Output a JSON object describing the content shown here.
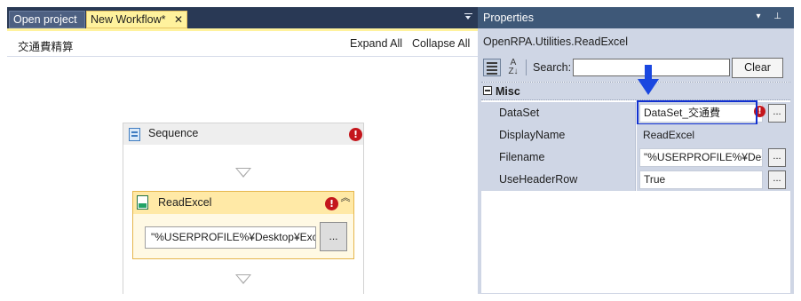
{
  "tabs": {
    "open_project": "Open project",
    "workflow": "New Workflow*",
    "close_glyph": "✕"
  },
  "designer": {
    "workflow_name": "交通費精算",
    "expand_all": "Expand All",
    "collapse_all": "Collapse All",
    "sequence": {
      "title": "Sequence",
      "error_glyph": "!"
    },
    "activity": {
      "title": "ReadExcel",
      "error_glyph": "!",
      "filename_value": "\"%USERPROFILE%¥Desktop¥Exc",
      "browse_label": "..."
    }
  },
  "properties": {
    "title": "Properties",
    "type_name": "OpenRPA.Utilities.ReadExcel",
    "search_label": "Search:",
    "search_value": "",
    "clear_label": "Clear",
    "category": "Misc",
    "rows": [
      {
        "name": "DataSet",
        "value": "DataSet_交通費",
        "button": "...",
        "error": "!"
      },
      {
        "name": "DisplayName",
        "value": "ReadExcel"
      },
      {
        "name": "Filename",
        "value": "\"%USERPROFILE%¥Desk",
        "button": "..."
      },
      {
        "name": "UseHeaderRow",
        "value": "True",
        "button": "..."
      }
    ]
  },
  "colors": {
    "chrome": "#293955",
    "active_tab": "#fff29d",
    "properties_title": "#3e5878",
    "properties_bg": "#cfd6e5",
    "error": "#c4161c",
    "highlight": "#1030d0",
    "callout_arrow": "#1a47e0"
  }
}
